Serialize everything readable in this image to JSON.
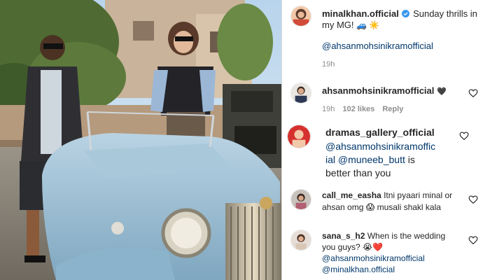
{
  "post": {
    "author": "minalkhan.official",
    "caption": "Sunday thrills in",
    "caption_line2": "my MG!",
    "caption_emojis": "🚙 ☀️",
    "mention": "@ahsanmohsinikramofficial",
    "time": "19h"
  },
  "comments": [
    {
      "username": "ahsanmohsinikramofficial",
      "text": "🖤",
      "time": "19h",
      "likes": "102 likes",
      "reply": "Reply"
    },
    {
      "username": "dramas_gallery_official",
      "mention1a": "@ahsanmohsinikramoffic",
      "mention1b": "ial",
      "mention2": "@muneeb_butt",
      "text_a": "is",
      "text_b": "better than you"
    },
    {
      "username": "call_me_easha",
      "text_a": "Itni pyaari minal or",
      "text_b": "ahsan omg",
      "emoji": "😱",
      "text_c": "musali shakl kala"
    },
    {
      "username": "sana_s_h2",
      "text_a": "When is the wedding",
      "text_b": "you guys?",
      "emoji": "😭❤️",
      "mention1": "@ahsanmohsinikramofficial",
      "mention2": "@minalkhan.official"
    }
  ],
  "colors": {
    "link": "#00376b",
    "meta": "#8e8e8e",
    "verified": "#3897f0",
    "divider": "#dbdbdb"
  },
  "icons": {
    "verified": "verified-badge-icon",
    "like": "heart-outline-icon"
  }
}
